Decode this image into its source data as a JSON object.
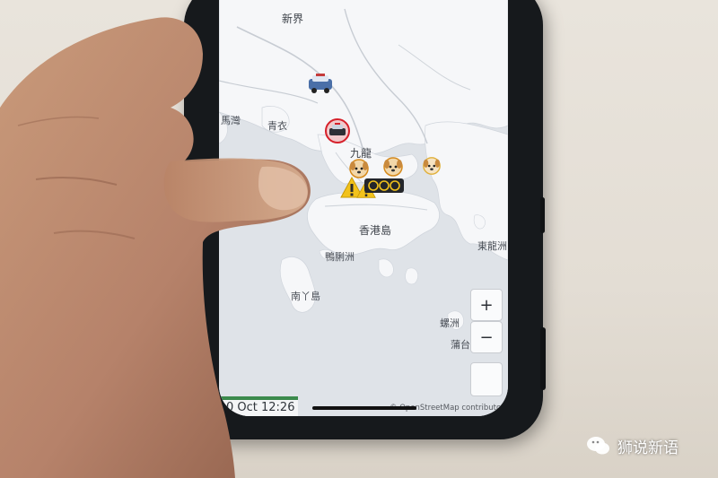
{
  "map": {
    "labels": {
      "new_territories": "新界",
      "ma_wan": "馬灣",
      "tsing_yi": "青衣",
      "kowloon": "九龍",
      "hk_island": "香港島",
      "ap_lei_chau": "鴨脷洲",
      "lamma": "南丫島",
      "east_lung_chau": "東龍洲",
      "po_toi_a": "蒲台",
      "waglan": "螺洲"
    },
    "zoom_in_label": "+",
    "zoom_out_label": "−",
    "timestamp": "0 Oct 12:26",
    "attribution": "© OpenStreetMap contributors",
    "markers": [
      {
        "type": "police-van-icon"
      },
      {
        "type": "police-car-icon"
      },
      {
        "type": "dog-face-icon"
      },
      {
        "type": "warning-sign-icon"
      },
      {
        "type": "bicycle-crowd-icon"
      }
    ]
  },
  "watermark": {
    "text": "狮说新语"
  },
  "colors": {
    "land": "#f6f7f9",
    "water": "#dfe3e8",
    "phone": "#16191c",
    "timestamp_bar": "#3b8a4c"
  }
}
